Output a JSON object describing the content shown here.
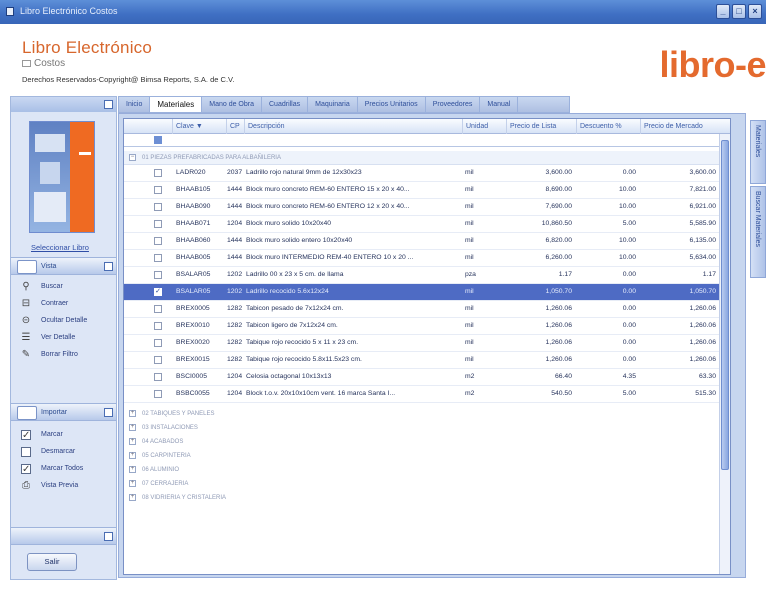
{
  "window": {
    "title": "Libro Electrónico Costos"
  },
  "header": {
    "app_name": "Libro Electrónico",
    "subtitle": "Costos",
    "copyright": "Derechos Reservados-Copyright@ Bimsa Reports, S.A. de C.V.",
    "brand": "libro-e"
  },
  "left": {
    "cover_link": "Seleccionar Libro",
    "vista_label": "Vista",
    "vista_items": [
      {
        "label": "Buscar",
        "icon": "binoculars-icon"
      },
      {
        "label": "Contraer",
        "icon": "collapse-icon"
      },
      {
        "label": "Ocultar Detalle",
        "icon": "hide-detail-icon"
      },
      {
        "label": "Ver Detalle",
        "icon": "show-detail-icon"
      },
      {
        "label": "Borrar Filtro",
        "icon": "eraser-icon"
      }
    ],
    "importar_label": "Importar",
    "importar_items": [
      {
        "label": "Marcar",
        "checked": true
      },
      {
        "label": "Desmarcar",
        "checked": false
      },
      {
        "label": "Marcar Todos",
        "checked": true
      },
      {
        "label": "Vista Previa",
        "checked": false
      }
    ],
    "exit_button": "Salir"
  },
  "tabs": [
    "Inicio",
    "Materiales",
    "Mano de Obra",
    "Cuadrillas",
    "Maquinaria",
    "Precios Unitarios",
    "Proveedores",
    "Manual"
  ],
  "active_tab": 1,
  "right_tabs": [
    "Materiales",
    "Buscar Materiales"
  ],
  "grid": {
    "headers": [
      "Clave",
      "CP",
      "Descripción",
      "Unidad",
      "Precio de Lista",
      "Descuento %",
      "Precio de Mercado"
    ],
    "clave_sort": "▼",
    "open_group": "01 PIEZAS PREFABRICADAS PARA ALBAÑILERIA",
    "rows": [
      {
        "clave": "LADR020",
        "cp": "2037",
        "desc": "Ladrillo rojo natural 9mm de  12x30x23",
        "unidad": "mil",
        "lista": "3,600.00",
        "desc_pct": "0.00",
        "mercado": "3,600.00",
        "checked": false
      },
      {
        "clave": "BHAAB105",
        "cp": "1444",
        "desc": "Block muro concreto REM-60 ENTERO 15 x 20 x 40...",
        "unidad": "mil",
        "lista": "8,690.00",
        "desc_pct": "10.00",
        "mercado": "7,821.00",
        "checked": false
      },
      {
        "clave": "BHAAB090",
        "cp": "1444",
        "desc": "Block muro concreto REM-60 ENTERO 12 x 20 x 40...",
        "unidad": "mil",
        "lista": "7,690.00",
        "desc_pct": "10.00",
        "mercado": "6,921.00",
        "checked": false
      },
      {
        "clave": "BHAAB071",
        "cp": "1204",
        "desc": "Block muro solido 10x20x40",
        "unidad": "mil",
        "lista": "10,860.50",
        "desc_pct": "5.00",
        "mercado": "5,585.90",
        "checked": false
      },
      {
        "clave": "BHAAB060",
        "cp": "1444",
        "desc": "Block muro solido entero 10x20x40",
        "unidad": "mil",
        "lista": "6,820.00",
        "desc_pct": "10.00",
        "mercado": "6,135.00",
        "checked": false
      },
      {
        "clave": "BHAAB005",
        "cp": "1444",
        "desc": "Block muro INTERMEDIO REM-40 ENTERO 10 x 20 ...",
        "unidad": "mil",
        "lista": "6,260.00",
        "desc_pct": "10.00",
        "mercado": "5,634.00",
        "checked": false
      },
      {
        "clave": "BSALAR05",
        "cp": "1202",
        "desc": "Ladrillo 00 x 23 x 5 cm. de llama",
        "unidad": "pza",
        "lista": "1.17",
        "desc_pct": "0.00",
        "mercado": "1.17",
        "checked": false
      },
      {
        "clave": "BSALAR05",
        "cp": "1202",
        "desc": "Ladrillo recocido 5.6x12x24",
        "unidad": "mil",
        "lista": "1,050.70",
        "desc_pct": "0.00",
        "mercado": "1,050.70",
        "checked": true,
        "selected": true
      },
      {
        "clave": "BREX0005",
        "cp": "1282",
        "desc": "Tabicon pesado de 7x12x24 cm.",
        "unidad": "mil",
        "lista": "1,260.06",
        "desc_pct": "0.00",
        "mercado": "1,260.06",
        "checked": false
      },
      {
        "clave": "BREX0010",
        "cp": "1282",
        "desc": "Tabicon ligero de 7x12x24 cm.",
        "unidad": "mil",
        "lista": "1,260.06",
        "desc_pct": "0.00",
        "mercado": "1,260.06",
        "checked": false
      },
      {
        "clave": "BREX0020",
        "cp": "1282",
        "desc": "Tabique rojo recocido 5 x 11 x 23 cm.",
        "unidad": "mil",
        "lista": "1,260.06",
        "desc_pct": "0.00",
        "mercado": "1,260.06",
        "checked": false
      },
      {
        "clave": "BREX0015",
        "cp": "1282",
        "desc": "Tabique rojo recocido 5.8x11.5x23 cm.",
        "unidad": "mil",
        "lista": "1,260.06",
        "desc_pct": "0.00",
        "mercado": "1,260.06",
        "checked": false
      },
      {
        "clave": "BSCI0005",
        "cp": "1204",
        "desc": "Celosia octagonal 10x13x13",
        "unidad": "m2",
        "lista": "66.40",
        "desc_pct": "4.35",
        "mercado": "63.30",
        "checked": false
      },
      {
        "clave": "BSBC0055",
        "cp": "1204",
        "desc": "Block t.o.v. 20x10x10cm vent. 16 marca Santa I...",
        "unidad": "m2",
        "lista": "540.50",
        "desc_pct": "5.00",
        "mercado": "515.30",
        "checked": false
      }
    ],
    "closed_groups": [
      "02 TABIQUES Y PANELES",
      "03 INSTALACIONES",
      "04 ACABADOS",
      "05 CARPINTERIA",
      "06 ALUMINIO",
      "07 CERRAJERIA",
      "08 VIDRIERIA Y CRISTALERIA"
    ]
  }
}
